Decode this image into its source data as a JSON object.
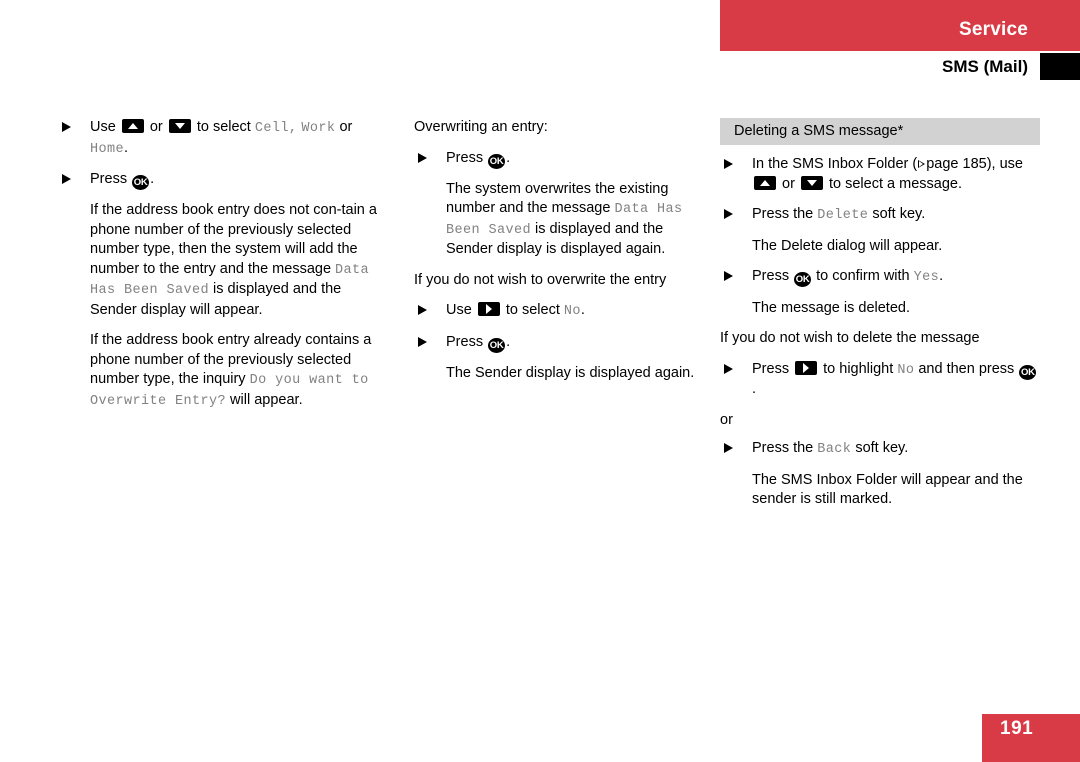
{
  "header": {
    "section_title": "Service",
    "chapter_title": "SMS (Mail)"
  },
  "footer": {
    "page_number": "191"
  },
  "colors": {
    "accent_red": "#d93b46",
    "heading_bar_gray": "#d2d2d2",
    "mono_gray": "#828282"
  },
  "columns": {
    "left": {
      "step1": {
        "pre": "Use",
        "mid": "or",
        "post": "to select",
        "display1": "Cell,",
        "display2": "Work",
        "conj": "or",
        "display3": "Home",
        "period": "."
      },
      "step2": {
        "pre": "Press",
        "period": "."
      },
      "note1_a": "If the address book entry does not con-tain a phone number of the previously selected number type, then the system will add the number to the entry and the message ",
      "note1_display": "Data Has Been Saved",
      "note1_b": " is displayed and the Sender display will appear.",
      "note2_a": "If the address book entry already contains a phone number of the previously selected number type, the inquiry ",
      "note2_display": "Do you want to Overwrite Entry?",
      "note2_b": " will appear."
    },
    "middle": {
      "lead_in": "Overwriting an entry:",
      "step1": {
        "pre": "Press",
        "period": "."
      },
      "note1_a": "The system overwrites the existing number and the message ",
      "note1_display": "Data Has Been Saved",
      "note1_b": " is displayed and the Sender display is displayed again.",
      "lead_in2": "If you do not wish to overwrite the entry",
      "step2": {
        "pre": "Use",
        "post": "to select",
        "display": "No",
        "period": "."
      },
      "step3": {
        "pre": "Press",
        "period": "."
      },
      "note2": "The Sender display is displayed again."
    },
    "right": {
      "section_heading": "Deleting a SMS message*",
      "step1": {
        "pre": "In the SMS Inbox Folder (",
        "ref_label": "page 185",
        "ref_close": "),",
        "line2_pre": "use",
        "line2_mid": "or",
        "line2_post": "to select a message."
      },
      "step2": {
        "pre": "Press the",
        "display": "Delete",
        "post": "soft key."
      },
      "note1": "The Delete dialog will appear.",
      "step3": {
        "pre": "Press",
        "mid": "to confirm with",
        "display": "Yes",
        "period": "."
      },
      "note2": "The message is deleted.",
      "lead_in": "If you do not wish to delete the message",
      "step4": {
        "pre": "Press",
        "mid": "to highlight",
        "display": "No",
        "post": "and then",
        "line2": "press",
        "period": "."
      },
      "or_label": "or",
      "step5": {
        "pre": "Press the",
        "display": "Back",
        "post": "soft key."
      },
      "note3": "The SMS Inbox Folder will appear and the sender is still marked."
    }
  }
}
